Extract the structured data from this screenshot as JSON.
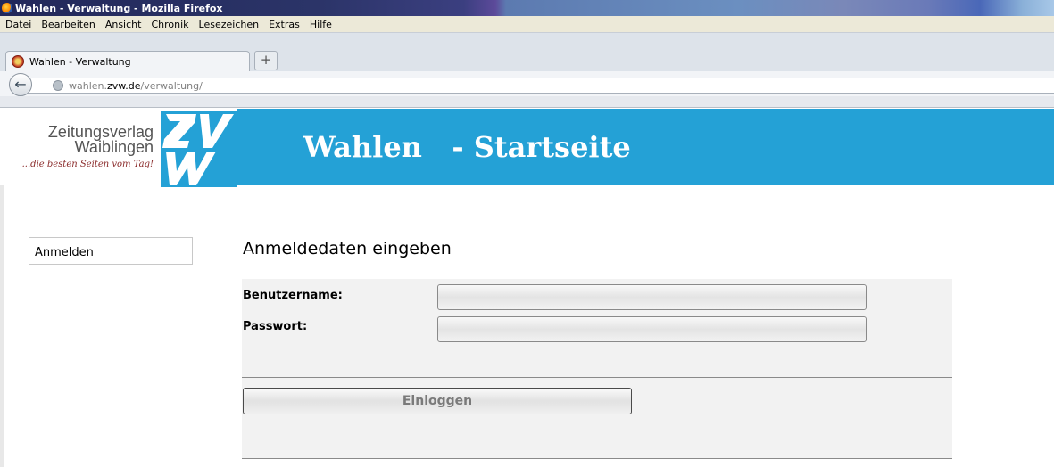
{
  "browser": {
    "window_title": "Wahlen - Verwaltung - Mozilla Firefox",
    "menu": [
      "Datei",
      "Bearbeiten",
      "Ansicht",
      "Chronik",
      "Lesezeichen",
      "Extras",
      "Hilfe"
    ],
    "tab_label": "Wahlen - Verwaltung",
    "new_tab_label": "+",
    "back_label": "←",
    "url": {
      "host_prefix": "wahlen.",
      "domain": "zvw.de",
      "path": "/verwaltung/"
    }
  },
  "header": {
    "logo_line1": "Zeitungsverlag",
    "logo_line2": "Waiblingen",
    "logo_slogan": "...die besten Seiten vom Tag!",
    "logo_mark": "ZVW",
    "title": "Wahlen   - Startseite",
    "band_color": "#24a1d6"
  },
  "sidebar": {
    "items": [
      {
        "label": "Anmelden"
      }
    ]
  },
  "login": {
    "heading": "Anmeldedaten eingeben",
    "username_label": "Benutzername:",
    "username_value": "",
    "password_label": "Passwort:",
    "password_value": "",
    "submit_label": "Einloggen"
  }
}
